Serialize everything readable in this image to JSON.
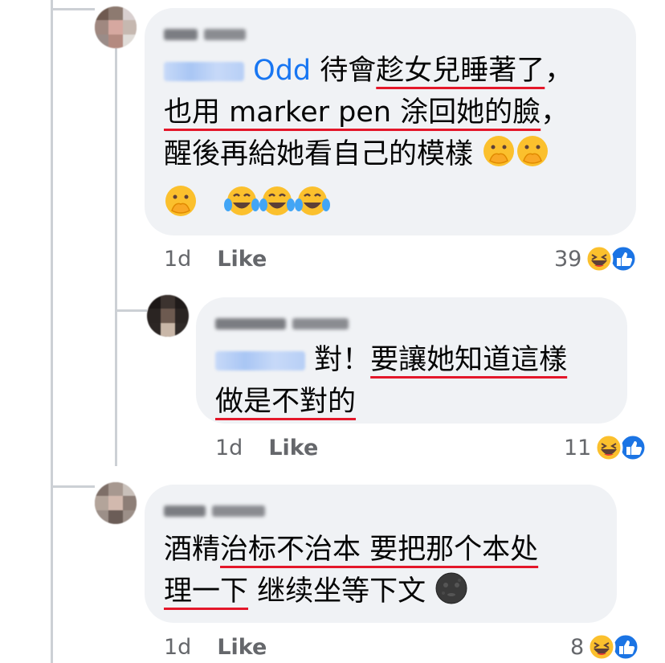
{
  "comments": [
    {
      "author_blurred": true,
      "mention_visible_text": "Odd",
      "lines": [
        [
          "待會",
          "趁女兒睡著了",
          "，"
        ],
        [
          "也用 marker pen 涂回她的臉",
          "，"
        ],
        [
          "醒後再給她看自己的模樣"
        ]
      ],
      "emoji_line": "🫢 😂😂😂",
      "time": "1d",
      "like_label": "Like",
      "reaction_count": "39"
    },
    {
      "author_blurred": true,
      "lines": [
        [
          "對！",
          "要讓她知道這樣"
        ],
        [
          "做是不對的"
        ]
      ],
      "time": "1d",
      "like_label": "Like",
      "reaction_count": "11"
    },
    {
      "author_blurred": true,
      "lines": [
        [
          "酒精",
          "治标不治本 要把那个本处"
        ],
        [
          "理一下",
          " 继续坐等下文"
        ]
      ],
      "time": "1d",
      "like_label": "Like",
      "reaction_count": "8"
    }
  ],
  "icons": {
    "reaction_haha": "haha-icon",
    "reaction_like": "like-icon",
    "emoji_hand_over_mouth": "hand-over-mouth-icon",
    "emoji_tears_of_joy": "tears-of-joy-icon",
    "emoji_new_moon_face": "new-moon-face-icon"
  },
  "colors": {
    "bubble": "#f0f2f5",
    "mention": "#1876f2",
    "underline": "#e4172a",
    "meta": "#65676b"
  }
}
